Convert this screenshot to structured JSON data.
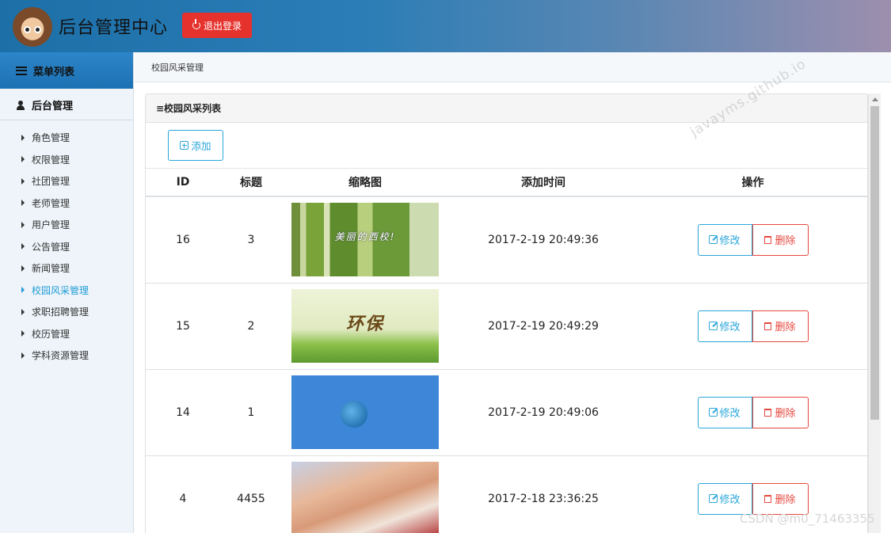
{
  "header": {
    "title": "后台管理中心",
    "logout_label": "退出登录"
  },
  "sidebar": {
    "menu_title": "菜单列表",
    "group_title": "后台管理",
    "items": [
      {
        "label": "角色管理"
      },
      {
        "label": "权限管理"
      },
      {
        "label": "社团管理"
      },
      {
        "label": "老师管理"
      },
      {
        "label": "用户管理"
      },
      {
        "label": "公告管理"
      },
      {
        "label": "新闻管理"
      },
      {
        "label": "校园风采管理",
        "active": true
      },
      {
        "label": "求职招聘管理"
      },
      {
        "label": "校历管理"
      },
      {
        "label": "学科资源管理"
      }
    ]
  },
  "breadcrumb": "校园风采管理",
  "panel": {
    "title": "≡校园风采列表",
    "add_label": "添加"
  },
  "table": {
    "columns": [
      "ID",
      "标题",
      "缩略图",
      "添加时间",
      "操作"
    ],
    "rows": [
      {
        "id": "16",
        "title": "3",
        "thumb_caption": "美丽的西校!",
        "time": "2017-2-19 20:49:36"
      },
      {
        "id": "15",
        "title": "2",
        "thumb_caption": "环保",
        "time": "2017-2-19 20:49:29"
      },
      {
        "id": "14",
        "title": "1",
        "thumb_caption": "",
        "time": "2017-2-19 20:49:06"
      },
      {
        "id": "4",
        "title": "4455",
        "thumb_caption": "",
        "time": "2017-2-18 23:36:25"
      }
    ],
    "edit_label": "修改",
    "delete_label": "删除"
  },
  "watermarks": {
    "site": "javayms.github.io",
    "csdn": "CSDN @m0_71463355"
  },
  "colors": {
    "accent": "#29a5d9",
    "danger": "#e5322d",
    "active_nav": "#1f9bd6"
  }
}
